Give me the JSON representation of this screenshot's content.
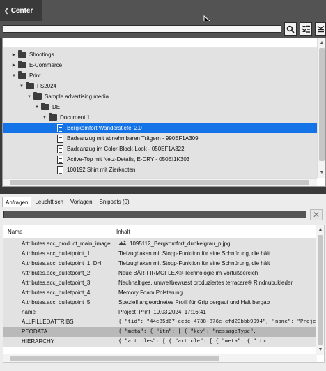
{
  "panel": {
    "title": "Center",
    "collapse_icon": "chevron-left-icon"
  },
  "toolbar": {
    "search_value": "",
    "buttons": [
      "search-icon",
      "filter-list-icon",
      "panel-menu-icon"
    ]
  },
  "tree": {
    "items": [
      {
        "label": "Shootings",
        "type": "folder",
        "expanded": false,
        "depth": 0
      },
      {
        "label": "E-Commerce",
        "type": "folder",
        "expanded": false,
        "depth": 0
      },
      {
        "label": "Print",
        "type": "folder",
        "expanded": true,
        "depth": 0
      },
      {
        "label": "FS2024",
        "type": "folder",
        "expanded": true,
        "depth": 1
      },
      {
        "label": "Sample advertising media",
        "type": "folder",
        "expanded": true,
        "depth": 2
      },
      {
        "label": "DE",
        "type": "folder",
        "expanded": true,
        "depth": 3
      },
      {
        "label": "Document 1",
        "type": "folder",
        "expanded": true,
        "depth": 4
      },
      {
        "label": "Bergkomfort Wanderstiefel 2.0",
        "type": "document",
        "depth": 5,
        "selected": true
      },
      {
        "label": "Badeanzug mit abnehmbaren Trägern - 990EF1A309",
        "type": "document",
        "depth": 5
      },
      {
        "label": "Badeanzug im Color-Block-Look - 050EF1A322",
        "type": "document",
        "depth": 5
      },
      {
        "label": "Active-Top mit Netz-Details, E-DRY - 050EI1K303",
        "type": "document",
        "depth": 5
      },
      {
        "label": "100192 Shirt mit Zierknoten",
        "type": "document",
        "depth": 5
      }
    ]
  },
  "tabs": [
    {
      "label": "Anfragen",
      "active": true
    },
    {
      "label": "Leuchttisch",
      "active": false
    },
    {
      "label": "Vorlagen",
      "active": false
    },
    {
      "label": "Snippets (0)",
      "active": false
    }
  ],
  "filter": {
    "value": ""
  },
  "table": {
    "columns": [
      "Name",
      "Inhalt"
    ],
    "rows": [
      {
        "name": "Attributes.acc_product_main_image",
        "value": "1095112_Bergkomfort_dunkelgrau_p.jpg",
        "icon": "image-file-icon"
      },
      {
        "name": "Attributes.acc_bulletpoint_1",
        "value": "Tiefzughaken mit Stopp-Funktion für eine Schnürung, die hält"
      },
      {
        "name": "Attributes.acc_bulletpoint_1_DH",
        "value": "Tiefzughaken mit Stopp-Funktion für eine Schnürung, die hält"
      },
      {
        "name": "Attributes.acc_bulletpoint_2",
        "value": "Neue BÄR-FIRMOFLEX®-Technologie im Vorfußbereich"
      },
      {
        "name": "Attributes.acc_bulletpoint_3",
        "value": "Nachhaltiges, umweltbewusst produziertes terracare® Rindnubukleder"
      },
      {
        "name": "Attributes.acc_bulletpoint_4",
        "value": "Memory Foam Polsterung"
      },
      {
        "name": "Attributes.acc_bulletpoint_5",
        "value": "Speziell angeordnetes Profil für Grip bergauf und Halt bergab"
      },
      {
        "name": "name",
        "value": "Project_Print_19.03.2024_17:16:41"
      },
      {
        "name": "ALLFILLEDATTRIBS",
        "value": "{    \"tid\": \"44e85d67-eede-4738-876e-cfd23bbb9994\",    \"name\": \"Project_Prin",
        "json": true
      },
      {
        "name": "PEODATA",
        "value": "{    \"meta\": {        \"itm\": [          {            \"key\": \"messageType\",",
        "json": true,
        "highlight": true
      },
      {
        "name": "HIERARCHY",
        "value": "{    \"articles\": [        {          \"article\": [          {          \"meta\": {      \"itm",
        "json": true
      }
    ]
  },
  "colors": {
    "selection": "#1473e6",
    "panel_dark": "#3a3a3a",
    "toolbar": "#535353"
  }
}
